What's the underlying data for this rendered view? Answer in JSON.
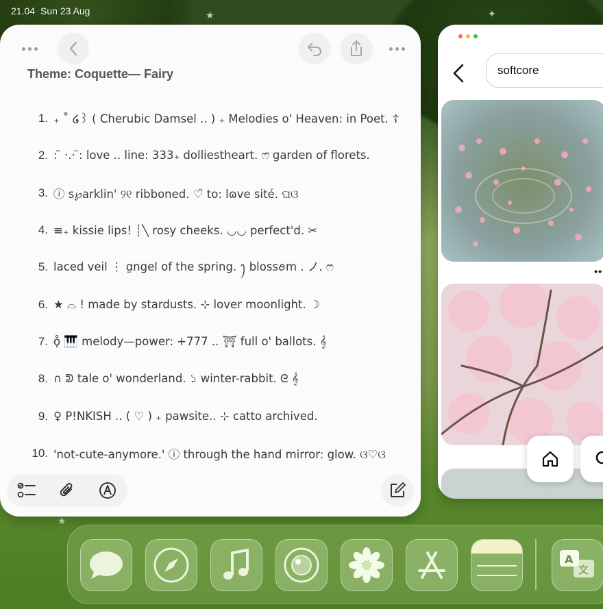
{
  "status_bar": {
    "time": "21.04",
    "date": "Sun 23 Aug"
  },
  "notes": {
    "title": "Theme: Coquette— Fairy",
    "items": [
      {
        "num": "1.",
        "text": "₊ ˚ ໒꒱ ( Cherubic Damsel .. ) ₊ Melodies o' Heaven: in Poet. ☦"
      },
      {
        "num": "2.",
        "text": ": ̈ ·.· ̈: love .. line: 333₊ dolliestheart. ෆ̈ garden of florets."
      },
      {
        "num": "3.",
        "text": "ⓘ s℘arklin'  ୨୧  ribboned.  ♡̆ to: lɷve  sité. ଘଓ"
      },
      {
        "num": "4.",
        "text": "≡₊ kissie lips!  ┊╲ rosy cheeks.  ◡◡  perfect'd. ✂"
      },
      {
        "num": "5.",
        "text": "laced veil ⋮ ɑ̤ngel of the spring. ꫂ blossꪮm . ノ. ෆ"
      },
      {
        "num": "6.",
        "text": "★ ⌓ ! made by stardusts. ⊹ lover moonlight. ☽"
      },
      {
        "num": "7.",
        "text": "ϙ̊  🎹 melody—power: +777 .. ⛩ full o' ballots. 𝄞"
      },
      {
        "num": "8.",
        "text": "∩ ᕲ tale o' wonderland. ১ winter-rabbit. ᘓ 𝄞"
      },
      {
        "num": "9.",
        "text": "♀ P!NKISH ..  ( ♡ )  ₊  pawsite.. ⊹ catto archived."
      },
      {
        "num": "10.",
        "text": "'not-cute-anymore.' ⓘ through the hand mirror: glow. ଓ♡ଓ"
      }
    ]
  },
  "pinterest": {
    "search_value": "softcore",
    "more_label": "•••"
  },
  "dock": {
    "apps": [
      "messages-icon",
      "safari-icon",
      "music-icon",
      "camera-icon",
      "photos-icon",
      "app-store-icon",
      "notes-icon",
      "translate-icon"
    ]
  },
  "colors": {
    "notes_bg": "#fbfbfb",
    "accent_red": "#ff5f57",
    "accent_yellow": "#febc2e",
    "accent_green": "#28c840"
  }
}
